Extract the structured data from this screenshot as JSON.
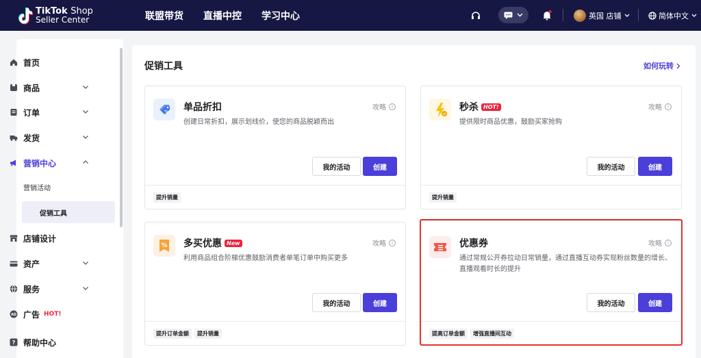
{
  "header": {
    "logo_line1": "TikTok",
    "logo_line1_b": "Shop",
    "logo_line2": "Seller Center",
    "nav": [
      "联盟带货",
      "直播中控",
      "学习中心"
    ],
    "store": "英国 店铺",
    "language": "简体中文"
  },
  "sidebar": {
    "items": [
      {
        "label": "首页"
      },
      {
        "label": "商品"
      },
      {
        "label": "订单"
      },
      {
        "label": "发货"
      },
      {
        "label": "营销中心"
      },
      {
        "label": "营销活动"
      },
      {
        "label": "促销工具"
      },
      {
        "label": "店铺设计"
      },
      {
        "label": "资产"
      },
      {
        "label": "服务"
      },
      {
        "label": "广告",
        "badge": "HOT!"
      },
      {
        "label": "帮助中心"
      }
    ]
  },
  "main": {
    "title": "促销工具",
    "howto": "如何玩转",
    "guide_label": "攻略",
    "my_activity_label": "我的活动",
    "create_label": "创建",
    "cards": [
      {
        "title": "单品折扣",
        "desc": "创建日常折扣，展示划线价，使您的商品脱颖而出",
        "tags": [
          "提升销量"
        ]
      },
      {
        "title": "秒杀",
        "badge": "HOT!",
        "desc": "提供限时商品优惠，鼓励买家抢购",
        "tags": [
          "提升销量"
        ]
      },
      {
        "title": "多买优惠",
        "badge": "New",
        "desc": "利用商品组合阶梯优惠鼓励消费者单笔订单中购买更多",
        "tags": [
          "提升订单金额",
          "提升销量"
        ]
      },
      {
        "title": "优惠券",
        "desc": "通过常规公开券拉动日常销量，通过直播互动券实现粉丝数量的增长、直播观看时长的提升",
        "tags": [
          "提高订单金额",
          "增强直播间互动"
        ]
      }
    ]
  },
  "colors": {
    "accent": "#4b3fd9",
    "topbar": "#171744",
    "hot": "#f0203a",
    "highlight": "#e0332d"
  }
}
